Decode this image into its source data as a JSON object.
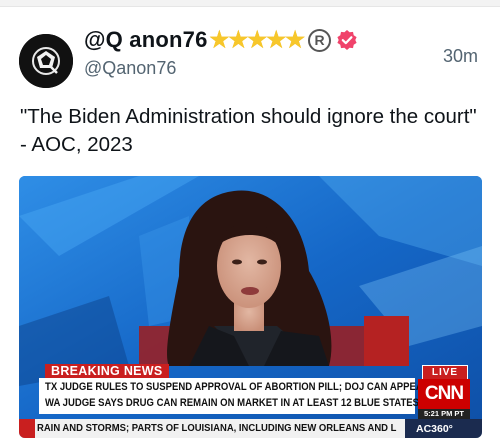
{
  "post": {
    "display_name": "@Q anon76",
    "stars": [
      "★",
      "★",
      "★",
      "★",
      "★"
    ],
    "registered_mark": "R",
    "username": "@Qanon76",
    "timestamp": "30m",
    "text": "\"The Biden Administration should ignore the court\" - AOC, 2023"
  },
  "media": {
    "breaking_label": "BREAKING NEWS",
    "headline_line1": "TX JUDGE RULES TO SUSPEND APPROVAL OF ABORTION PILL; DOJ CAN APPEAL;",
    "headline_line2": "WA JUDGE SAYS DRUG CAN REMAIN ON MARKET IN AT LEAST 12 BLUE STATES",
    "live_label": "LIVE",
    "network_logo": "CNN",
    "time_label": "5:21 PM PT",
    "ticker_text": "RAIN AND STORMS; PARTS OF LOUISIANA, INCLUDING NEW ORLEANS AND L",
    "show_label": "AC360°"
  },
  "colors": {
    "star": "#f7c72b",
    "verified": "#f0436b",
    "breaking": "#c91f1f",
    "studio_blue": "#1a7ad9"
  }
}
